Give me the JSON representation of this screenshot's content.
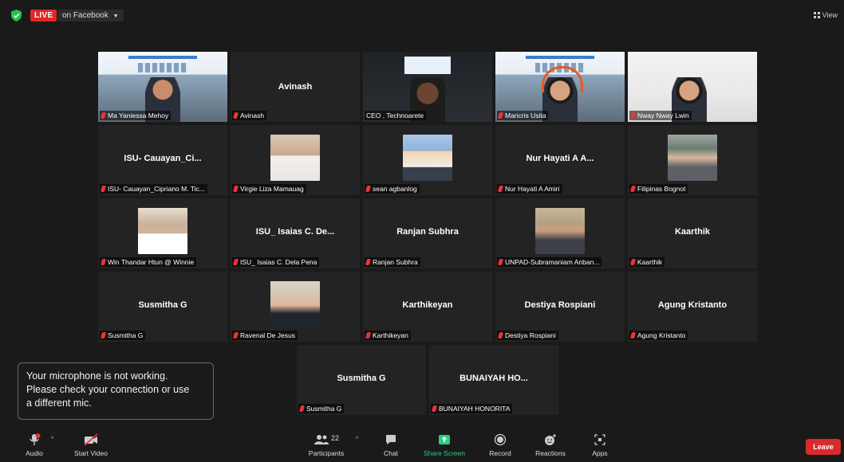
{
  "topbar": {
    "live_label": "LIVE",
    "stream_target": "on Facebook",
    "view_label": "View"
  },
  "colors": {
    "live": "#e02828",
    "active_speaker_border": "#c5e000",
    "leave": "#d92b2b",
    "share_green": "#27d17f"
  },
  "tiles": [
    {
      "label": "Ma Yaniessa Mehoy",
      "big_name": "",
      "kind": "conference-photo"
    },
    {
      "label": "Avinash",
      "big_name": "Avinash",
      "kind": "name"
    },
    {
      "label": "CEO , Technoarete",
      "big_name": "",
      "kind": "ceo-video"
    },
    {
      "label": "Maricris Usita",
      "big_name": "",
      "kind": "conference-headset"
    },
    {
      "label": "Nway Nway Lwin",
      "big_name": "",
      "kind": "plain-video"
    },
    {
      "label": "ISU- Cauayan_Cipriano M. Tic...",
      "big_name": "ISU- Cauayan_Ci...",
      "kind": "name"
    },
    {
      "label": "Virgie Liza Mamauag",
      "big_name": "",
      "kind": "photo-f1"
    },
    {
      "label": "sean agbanlog",
      "big_name": "",
      "kind": "photo-m1"
    },
    {
      "label": "Nur Hayati A Amiri",
      "big_name": "Nur Hayati A A...",
      "kind": "name"
    },
    {
      "label": "Filipinas Bognot",
      "big_name": "",
      "kind": "photo-f3"
    },
    {
      "label": "Win Thandar Htun @ Winnie",
      "big_name": "",
      "kind": "photo-f2"
    },
    {
      "label": "ISU_ Isaias C. Dela Pena",
      "big_name": "ISU_ Isaias C. De...",
      "kind": "name"
    },
    {
      "label": "Ranjan Subhra",
      "big_name": "Ranjan Subhra",
      "kind": "name"
    },
    {
      "label": "UNPAD-Subramaniam Anban...",
      "big_name": "",
      "kind": "photo-m2"
    },
    {
      "label": "Kaarthik",
      "big_name": "Kaarthik",
      "kind": "name"
    },
    {
      "label": "Susmitha G",
      "big_name": "Susmitha G",
      "kind": "name"
    },
    {
      "label": "Ravenal De Jesus",
      "big_name": "",
      "kind": "photo-m3"
    },
    {
      "label": "Karthikeyan",
      "big_name": "Karthikeyan",
      "kind": "name"
    },
    {
      "label": "Destiya Rospiani",
      "big_name": "Destiya Rospiani",
      "kind": "name"
    },
    {
      "label": "Agung Kristanto",
      "big_name": "Agung Kristanto",
      "kind": "name"
    },
    {
      "label": "Susmitha G",
      "big_name": "Susmitha G",
      "kind": "name"
    },
    {
      "label": "BUNAIYAH HONORITA",
      "big_name": "BUNAIYAH HO...",
      "kind": "name"
    }
  ],
  "toast": {
    "line1": "Your microphone is not working.",
    "line2": "Please check your connection or use",
    "line3": "a different mic."
  },
  "toolbar": {
    "audio": "Audio",
    "start_video": "Start Video",
    "participants": "Participants",
    "participants_count": "22",
    "chat": "Chat",
    "share_screen": "Share Screen",
    "record": "Record",
    "reactions": "Reactions",
    "apps": "Apps",
    "leave": "Leave"
  }
}
